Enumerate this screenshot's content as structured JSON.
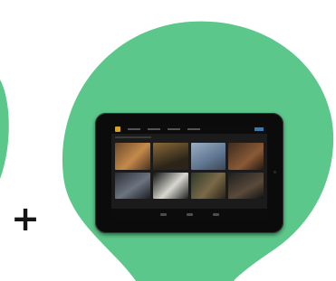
{
  "plus": {
    "symbol": "+"
  },
  "colors": {
    "bubble": "#5cc78b",
    "left_shape": "#5cc78b",
    "plus": "#151515",
    "tablet_bezel": "#0b0b0b"
  },
  "tablet": {
    "screen": {
      "thumbnails": [
        {
          "icon": "video-thumbnail"
        },
        {
          "icon": "video-thumbnail"
        },
        {
          "icon": "video-thumbnail"
        },
        {
          "icon": "video-thumbnail"
        },
        {
          "icon": "video-thumbnail"
        },
        {
          "icon": "video-thumbnail"
        },
        {
          "icon": "video-thumbnail"
        },
        {
          "icon": "video-thumbnail"
        }
      ],
      "nav_icons": [
        "back-icon",
        "home-icon",
        "recent-apps-icon"
      ]
    }
  }
}
